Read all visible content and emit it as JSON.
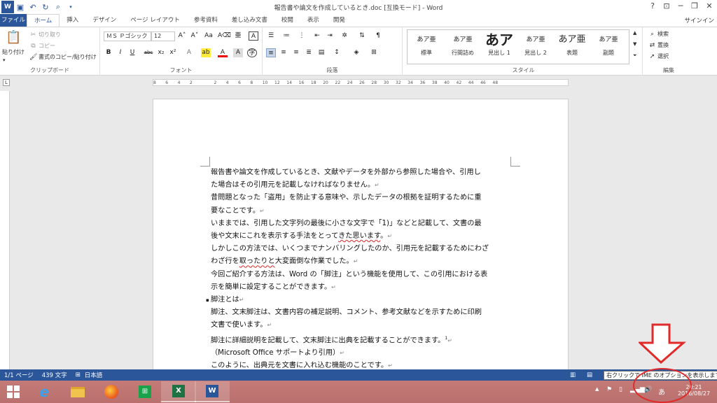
{
  "title_bar": {
    "title": "報告書や論文を作成しているとき.doc [互換モード] - Word",
    "help": "?",
    "minimize": "─",
    "restore": "❐",
    "close": "✕",
    "ribbon_options": "⊡"
  },
  "tabs": [
    "ファイル",
    "ホーム",
    "挿入",
    "デザイン",
    "ページ レイアウト",
    "参考資料",
    "差し込み文書",
    "校閲",
    "表示",
    "開発"
  ],
  "signin": "サインイン",
  "clipboard": {
    "paste": "貼り付け",
    "cut": "切り取り",
    "copy": "コピー",
    "format_painter": "書式のコピー/貼り付け",
    "label": "クリップボード"
  },
  "font": {
    "name": "ＭＳ Ｐゴシック",
    "size": "12",
    "label": "フォント"
  },
  "paragraph": {
    "label": "段落"
  },
  "styles": {
    "label": "スタイル",
    "items": [
      {
        "sample": "あア亜",
        "name": "標準"
      },
      {
        "sample": "あア亜",
        "name": "行間詰め"
      },
      {
        "sample": "あア",
        "name": "見出し 1"
      },
      {
        "sample": "あア亜",
        "name": "見出し 2"
      },
      {
        "sample": "あア亜",
        "name": "表題"
      },
      {
        "sample": "あア亜",
        "name": "副題"
      }
    ]
  },
  "editing": {
    "find": "検索",
    "replace": "置換",
    "select": "選択",
    "label": "編集"
  },
  "ruler_ticks": [
    "8",
    "6",
    "4",
    "2",
    "",
    "2",
    "4",
    "6",
    "8",
    "10",
    "12",
    "14",
    "16",
    "18",
    "20",
    "22",
    "24",
    "26",
    "28",
    "30",
    "32",
    "34",
    "36",
    "38",
    "40",
    "42",
    "44",
    "46",
    "48"
  ],
  "document": {
    "lines": [
      {
        "t": "報告書や論文を作成しているとき、文献やデータを外部から参照した場合や、引用し",
        "m": ""
      },
      {
        "t": "た場合はその引用元を記載しなければなりません。",
        "m": "↵"
      },
      {
        "t": "昔問題となった「盗用」を防止する意味や、示したデータの根拠を証明するために重",
        "m": ""
      },
      {
        "t": "要なことです。",
        "m": "↵"
      },
      {
        "t": "いままでは、引用した文字列の最後に小さな文字で「1)」などと記載して、文書の最",
        "m": ""
      },
      {
        "t": "後や文末にこれを表示する手法をとってきた思います。",
        "m": "↵"
      },
      {
        "t": "しかしこの方法では、いくつまでナンバリングしたのか、引用元を記載するためにわざ",
        "m": ""
      },
      {
        "t": "わざ行を取ったりと大変面倒な作業でした。",
        "m": "↵"
      },
      {
        "t": "今回ご紹介する方法は、Word の「脚注」という機能を使用して、この引用における表",
        "m": ""
      },
      {
        "t": "示を簡単に設定することができます。",
        "m": "↵"
      },
      {
        "t": "脚注とは",
        "m": "↵",
        "bullet": "▪"
      },
      {
        "t": "脚注、文末脚注は、文書内容の補足説明、コメント、参考文献などを示すために印刷",
        "m": ""
      },
      {
        "t": "文書で使います。",
        "m": "↵"
      },
      {
        "t": "脚注に詳細説明を記載して、文末脚注に出典を記載することができます。",
        "m": "↵",
        "sup": "1"
      },
      {
        "t": "（Microsoft Office サポートより引用）",
        "m": "↵"
      },
      {
        "t": "このように、出典元を文書に入れ込む機能のことです。",
        "m": "↵"
      }
    ]
  },
  "status": {
    "page": "1/1 ページ",
    "words": "439 文字",
    "lang": "日本語"
  },
  "tooltip": "右クリックで IME のオプションを表示します。",
  "tray": {
    "ime": "あ",
    "time": "20:21",
    "date": "2016/08/27"
  },
  "colors": {
    "accent": "#2b579a",
    "annotation": "#e12a2a"
  }
}
